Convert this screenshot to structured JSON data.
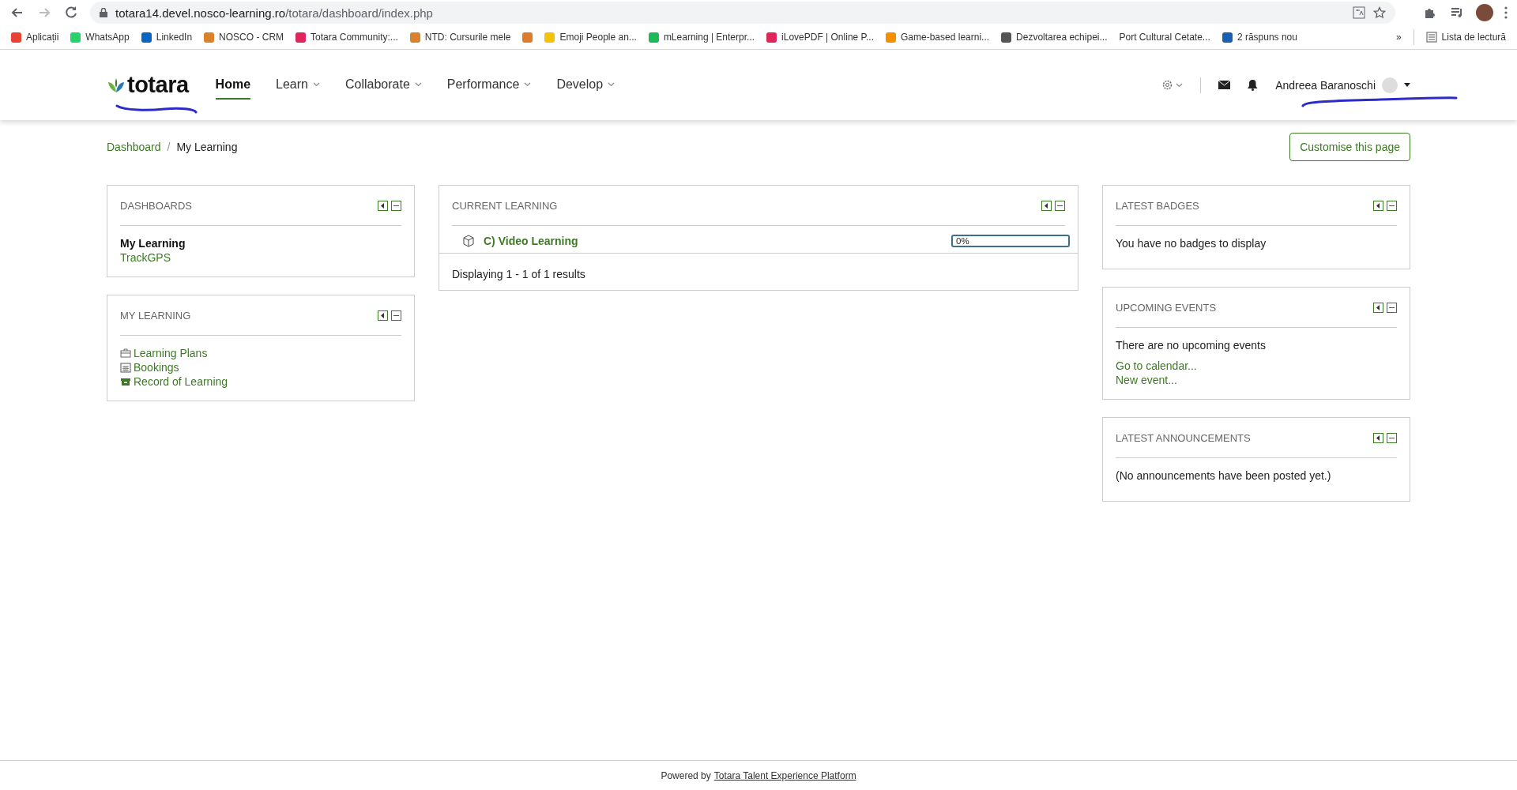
{
  "browser": {
    "url_host": "totara14.devel.nosco-learning.ro",
    "url_path": "/totara/dashboard/index.php",
    "bookmarks": [
      {
        "label": "Aplicații"
      },
      {
        "label": "WhatsApp"
      },
      {
        "label": "LinkedIn"
      },
      {
        "label": "NOSCO - CRM"
      },
      {
        "label": "Totara Community:..."
      },
      {
        "label": "NTD: Cursurile mele"
      },
      {
        "kind": "icon_only"
      },
      {
        "label": "Emoji People an..."
      },
      {
        "label": "mLearning | Enterpr..."
      },
      {
        "label": "iLovePDF | Online P..."
      },
      {
        "label": "Game-based learni..."
      },
      {
        "label": "Dezvoltarea echipei..."
      },
      {
        "label": "Port Cultural Cetate..."
      },
      {
        "label": "2 răspuns nou"
      }
    ],
    "more": "»",
    "reading_list": "Lista de lectură"
  },
  "header": {
    "logo": "totara",
    "nav": [
      {
        "label": "Home",
        "selected": true,
        "has_menu": false
      },
      {
        "label": "Learn",
        "selected": false,
        "has_menu": true
      },
      {
        "label": "Collaborate",
        "selected": false,
        "has_menu": true
      },
      {
        "label": "Performance",
        "selected": false,
        "has_menu": true
      },
      {
        "label": "Develop",
        "selected": false,
        "has_menu": true
      }
    ],
    "user_name": "Andreea Baranoschi"
  },
  "breadcrumb": [
    "Dashboard",
    "My Learning"
  ],
  "breadcrumb_separator": "/",
  "customise_button": "Customise this page",
  "columns": [
    {
      "blocks": [
        {
          "title": "DASHBOARDS",
          "items": [
            {
              "kind": "current",
              "text": "My Learning"
            },
            {
              "kind": "link",
              "text": "TrackGPS"
            }
          ]
        },
        {
          "title": "MY LEARNING",
          "items": [
            {
              "kind": "icon_link",
              "text": "Learning Plans"
            },
            {
              "kind": "icon_link",
              "text": "Bookings"
            },
            {
              "kind": "icon_link",
              "text": "Record of Learning"
            }
          ]
        }
      ]
    },
    {
      "blocks": [
        {
          "title": "CURRENT LEARNING",
          "items": [
            {
              "kind": "course",
              "text": "C) Video Learning",
              "progress": "0%",
              "level": 0
            }
          ],
          "footer": "Displaying 1 - 1 of 1 results"
        }
      ]
    },
    {
      "blocks": [
        {
          "title": "LATEST BADGES",
          "items": [
            {
              "kind": "text",
              "text": "You have no badges to display"
            }
          ]
        },
        {
          "title": "UPCOMING EVENTS",
          "items": [
            {
              "kind": "text",
              "text": "There are no upcoming events"
            },
            {
              "kind": "link",
              "text": "Go to calendar..."
            },
            {
              "kind": "link",
              "text": "New event..."
            }
          ]
        },
        {
          "title": "LATEST ANNOUNCEMENTS",
          "items": [
            {
              "kind": "text",
              "text": "(No announcements have been posted yet.)"
            }
          ]
        }
      ]
    }
  ],
  "footer": {
    "prefix": "Powered by",
    "link": "Totara Talent Experience Platform"
  }
}
